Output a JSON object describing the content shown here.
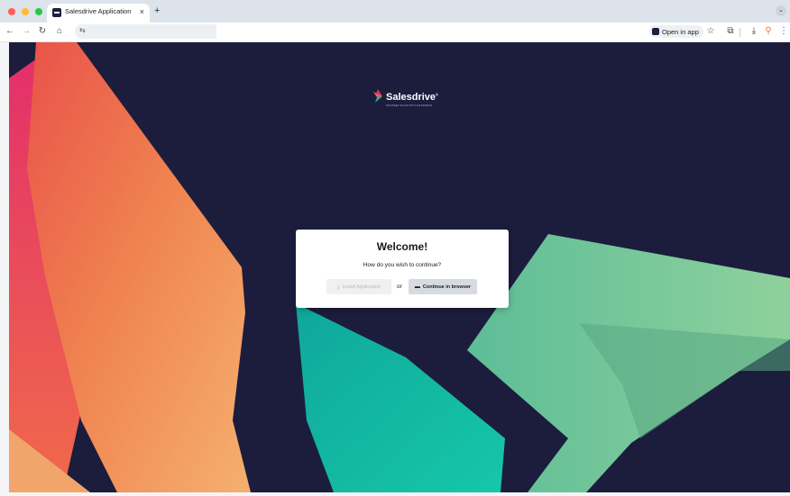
{
  "browser": {
    "tab_title": "Salesdrive Application",
    "tab_close": "×",
    "new_tab": "+",
    "tab_menu": "⌄",
    "nav": {
      "back": "←",
      "forward": "→",
      "reload": "↻",
      "home": "⌂",
      "site_info": "⇆"
    },
    "open_in_app_label": "Open in app",
    "bookmark": "☆",
    "extensions": "⧉",
    "download": "⤓",
    "profile": "⚲",
    "menu": "⋮"
  },
  "page": {
    "logo_text": "Salesdrive",
    "logo_mark": "®",
    "logo_tagline": "ENGINEER SALES WITH SALESDRIVE",
    "dialog": {
      "title": "Welcome!",
      "subtitle": "How do you wish to continue?",
      "install_icon": "⤓",
      "install_label": "Install Application",
      "or": "or",
      "continue_icon": "▬",
      "continue_label": "Continue in browser"
    }
  },
  "colors": {
    "background": "#1c1d3d",
    "orange": "#ef7a4a",
    "teal": "#13b2a0",
    "green": "#6cc39a"
  }
}
